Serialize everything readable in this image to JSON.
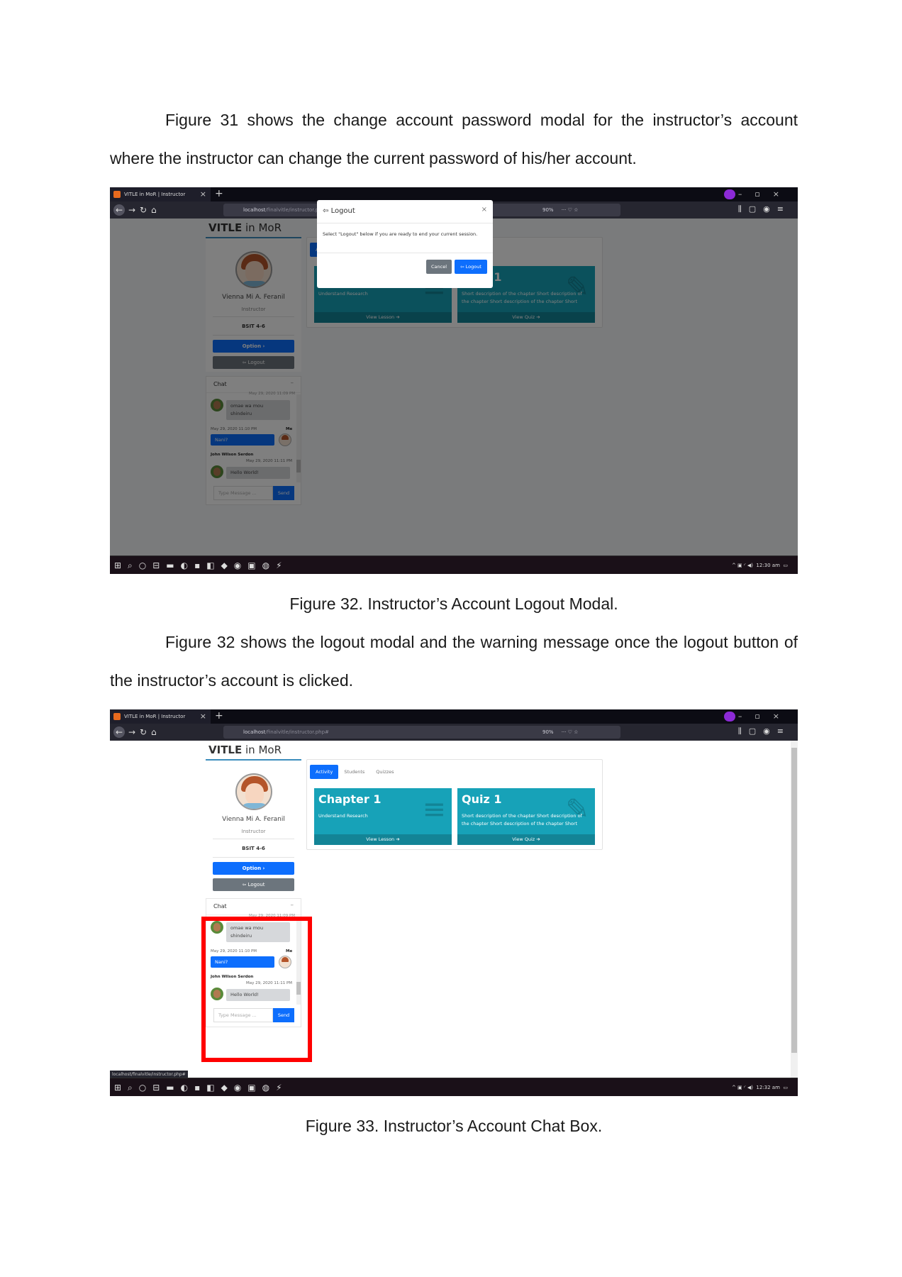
{
  "paragraphs": {
    "p1": "Figure 31 shows the change account password modal for the instructor’s account where the instructor can change the current password of his/her account.",
    "p2": "Figure 32 shows the logout modal and the warning message once the logout button of the instructor’s account is clicked."
  },
  "captions": {
    "fig32": "Figure 32. Instructor’s Account Logout Modal.",
    "fig33": "Figure 33. Instructor’s Account Chat Box."
  },
  "browser": {
    "tab_title": "VITLE in MoR | Instructor",
    "url_host": "localhost",
    "url_path": "/finalvitle/instructor.php#",
    "zoom": "90%",
    "status_url": "localhost/finalvitle/instructor.php#"
  },
  "app": {
    "brand_bold": "VITLE",
    "brand_rest": " in MoR",
    "profile": {
      "name": "Vienna Mi A. Feranil",
      "role": "Instructor",
      "section": "BSIT 4-6"
    },
    "option_label": "Option ›",
    "logout_label": "Logout",
    "tabs": [
      "Activity",
      "Students",
      "Quizzes"
    ],
    "cards": [
      {
        "title": "Chapter 1",
        "description": "Understand Research",
        "footer": "View Lesson ➔",
        "icon": "list-icon"
      },
      {
        "title": "Quiz 1",
        "description": "Short description of the chapter Short description of the chapter Short description of the chapter Short",
        "footer": "View Quiz ➔",
        "icon": "edit-icon"
      }
    ],
    "chat": {
      "title": "Chat",
      "minimize": "–",
      "partial_time": "May 29, 2020 11:09 PM",
      "messages": [
        {
          "text": "omae wa mou shindeiru"
        },
        {
          "meta_time": "May 29, 2020 11:10 PM",
          "meta_name": "Me",
          "text": "Nani?"
        },
        {
          "meta_name": "John Wilson Serdon",
          "meta_time": "May 29, 2020 11:11 PM",
          "text": "Hello World!"
        }
      ],
      "input_placeholder": "Type Message ...",
      "send_label": "Send"
    },
    "modal": {
      "title": "Logout",
      "close": "×",
      "body": "Select \"Logout\" below if you are ready to end your current session.",
      "cancel_label": "Cancel",
      "confirm_label": "Logout"
    }
  },
  "taskbar": {
    "time_fig32": "12:30 am",
    "time_fig33": "12:32 am"
  },
  "colors": {
    "primary": "#0d6efd",
    "card": "#17a2b8",
    "secondary": "#6c757d",
    "highlight": "#ff0000"
  }
}
